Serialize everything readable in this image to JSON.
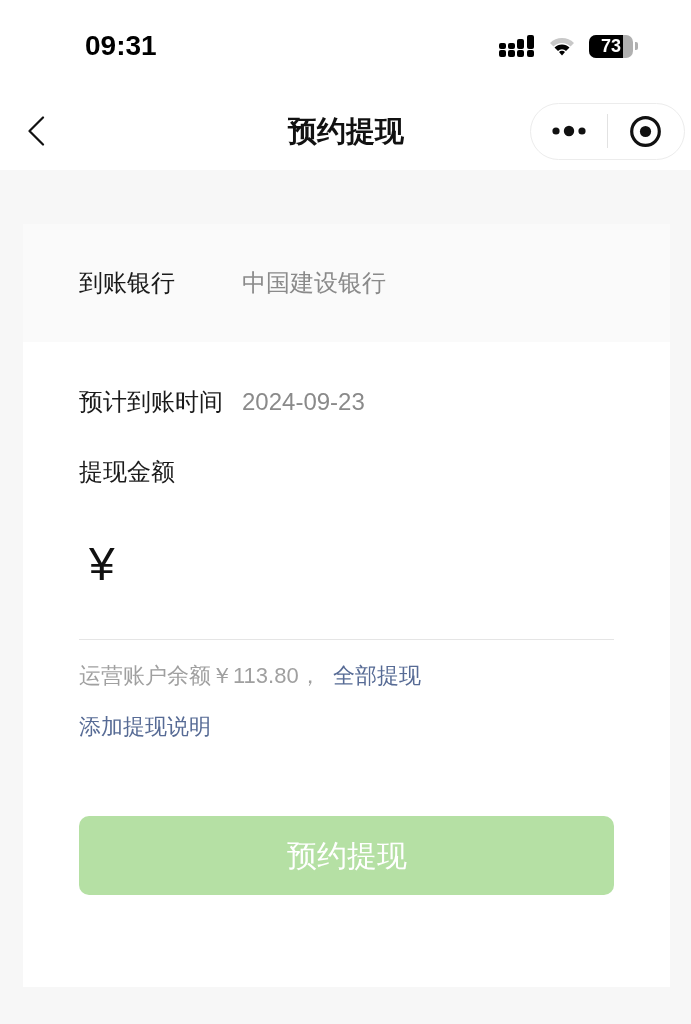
{
  "status_bar": {
    "time": "09:31",
    "battery": "73"
  },
  "nav_bar": {
    "title": "预约提现"
  },
  "bank": {
    "label": "到账银行",
    "value": "中国建设银行"
  },
  "arrival": {
    "label": "预计到账时间",
    "value": "2024-09-23"
  },
  "amount": {
    "label": "提现金额",
    "currency": "¥"
  },
  "balance": {
    "text": "运营账户余额￥113.80，",
    "action": "全部提现"
  },
  "note_link": "添加提现说明",
  "submit_button": {
    "label": "预约提现",
    "disabled": true
  }
}
